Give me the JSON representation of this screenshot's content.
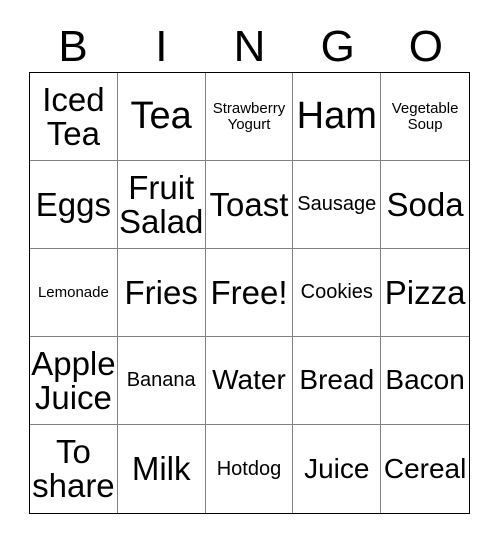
{
  "header": {
    "letters": [
      "B",
      "I",
      "N",
      "G",
      "O"
    ]
  },
  "colors": {
    "grid_border": "#000000",
    "cell_divider": "#808080",
    "cell_background": "#ffffff",
    "text": "#000000"
  },
  "grid": {
    "columns": 5,
    "rows": 5,
    "free_space_label": "Free!",
    "cells": [
      [
        {
          "label": "Iced\nTea",
          "size": "lg"
        },
        {
          "label": "Tea",
          "size": "xl"
        },
        {
          "label": "Strawberry\nYogurt",
          "size": "xs"
        },
        {
          "label": "Ham",
          "size": "xl"
        },
        {
          "label": "Vegetable\nSoup",
          "size": "xs"
        }
      ],
      [
        {
          "label": "Eggs",
          "size": "lg"
        },
        {
          "label": "Fruit\nSalad",
          "size": "lg"
        },
        {
          "label": "Toast",
          "size": "lg"
        },
        {
          "label": "Sausage",
          "size": "sm"
        },
        {
          "label": "Soda",
          "size": "lg"
        }
      ],
      [
        {
          "label": "Lemonade",
          "size": "xs"
        },
        {
          "label": "Fries",
          "size": "lg"
        },
        {
          "label": "Free!",
          "size": "lg"
        },
        {
          "label": "Cookies",
          "size": "sm"
        },
        {
          "label": "Pizza",
          "size": "lg"
        }
      ],
      [
        {
          "label": "Apple\nJuice",
          "size": "lg"
        },
        {
          "label": "Banana",
          "size": "sm"
        },
        {
          "label": "Water",
          "size": "md"
        },
        {
          "label": "Bread",
          "size": "md"
        },
        {
          "label": "Bacon",
          "size": "md"
        }
      ],
      [
        {
          "label": "To\nshare",
          "size": "lg"
        },
        {
          "label": "Milk",
          "size": "lg"
        },
        {
          "label": "Hotdog",
          "size": "sm"
        },
        {
          "label": "Juice",
          "size": "md"
        },
        {
          "label": "Cereal",
          "size": "md"
        }
      ]
    ]
  }
}
